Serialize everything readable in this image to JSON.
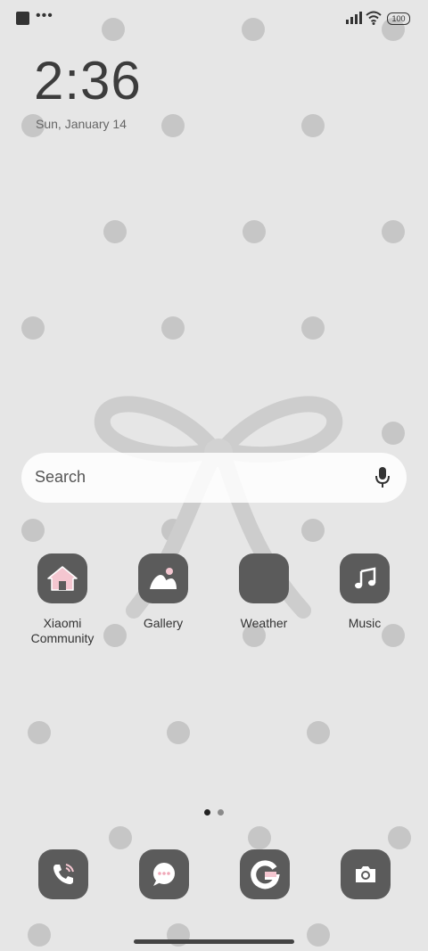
{
  "status_bar": {
    "battery": "100"
  },
  "clock": {
    "time": "2:36",
    "date": "Sun, January 14"
  },
  "search": {
    "placeholder": "Search"
  },
  "apps": [
    {
      "label": "Xiaomi\nCommunity",
      "icon": "home-icon"
    },
    {
      "label": "Gallery",
      "icon": "gallery-icon"
    },
    {
      "label": "Weather",
      "icon": "weather-icon"
    },
    {
      "label": "Music",
      "icon": "music-note-icon"
    }
  ],
  "pager": {
    "pages": 2,
    "current": 1
  },
  "dock": [
    {
      "name": "phone",
      "icon": "phone-icon"
    },
    {
      "name": "messages",
      "icon": "chat-bubble-icon"
    },
    {
      "name": "google",
      "icon": "google-g-icon"
    },
    {
      "name": "camera",
      "icon": "camera-icon"
    }
  ],
  "colors": {
    "background": "#e6e6e6",
    "tile": "#5b5b5b",
    "accent_pink": "#f4c6d0",
    "dot": "#c6c6c6"
  }
}
